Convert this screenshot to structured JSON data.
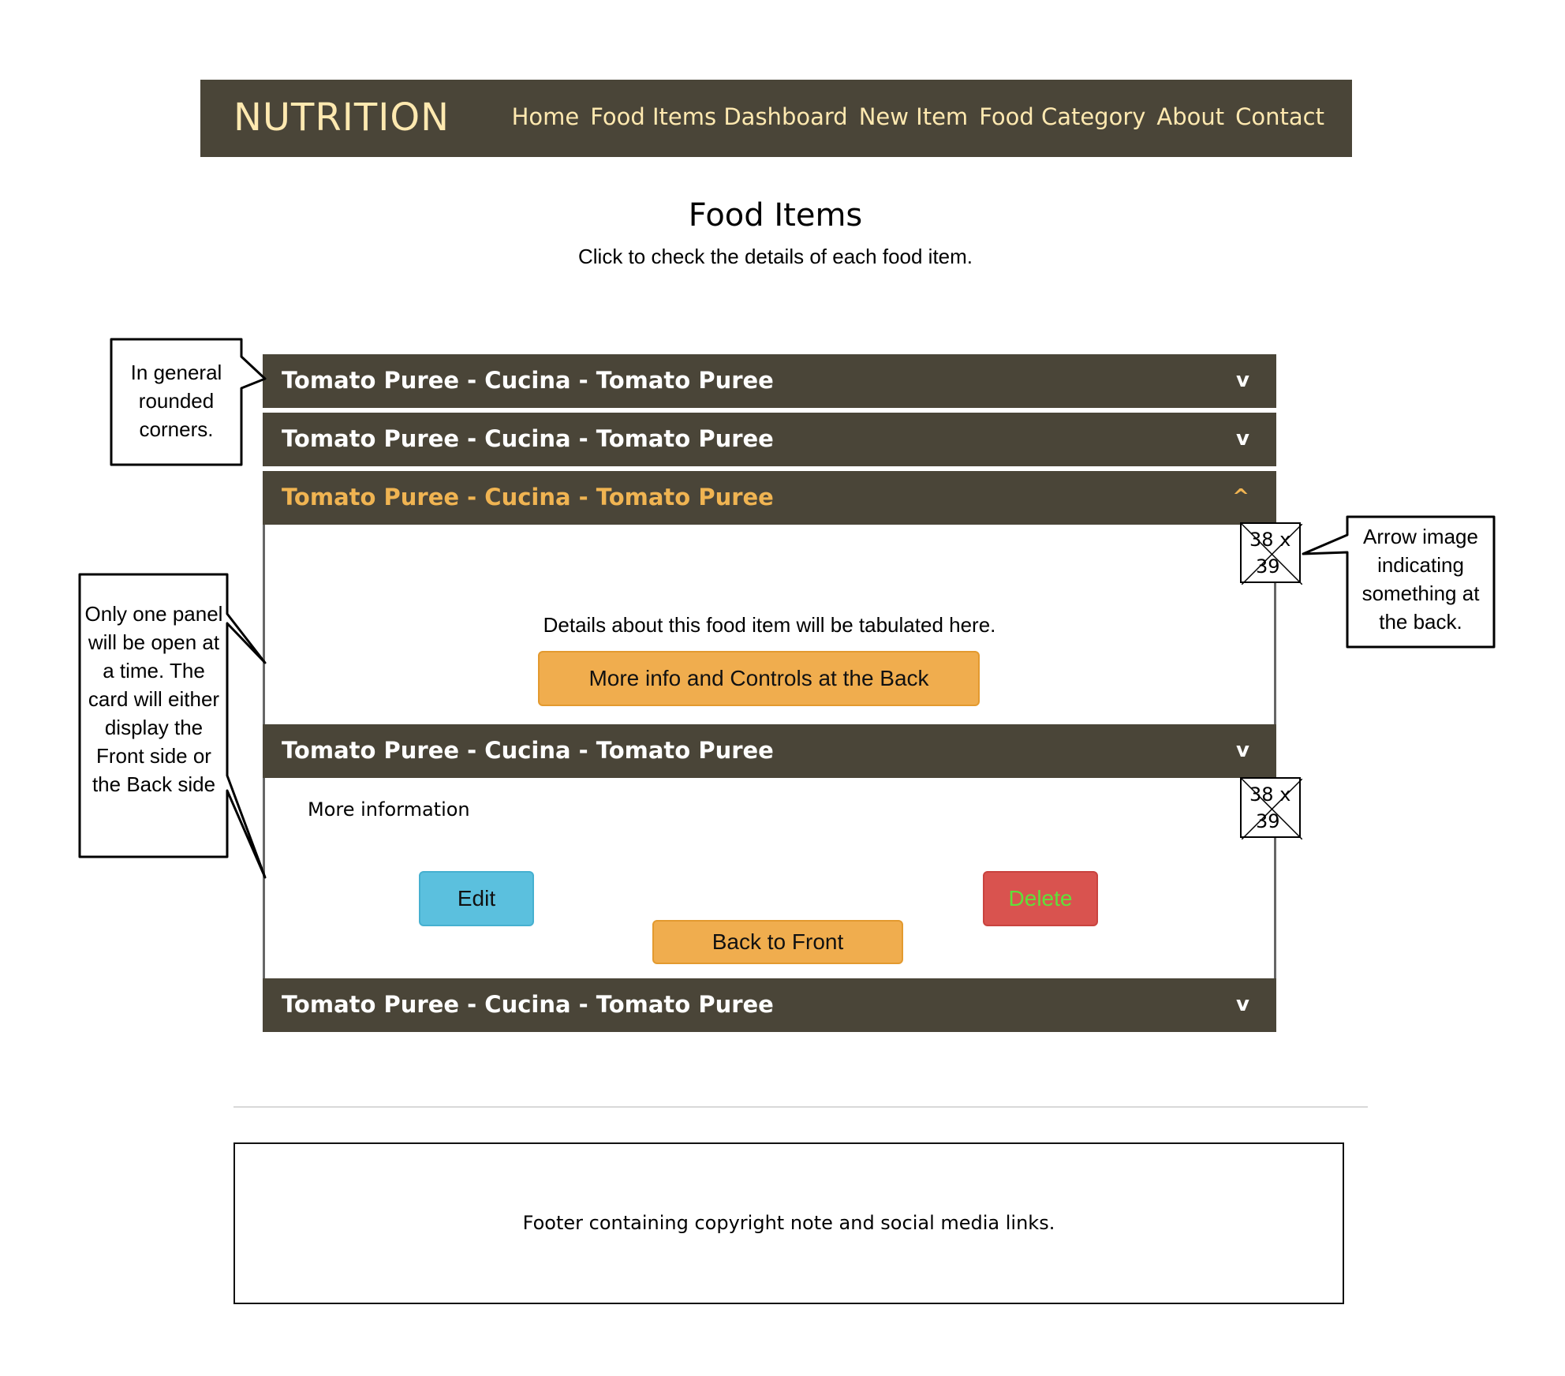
{
  "navbar": {
    "brand": "NUTRITION",
    "links": [
      "Home",
      "Food Items Dashboard",
      "New Item",
      "Food Category",
      "About",
      "Contact"
    ]
  },
  "page": {
    "title": "Food Items",
    "subtitle": "Click to check the details of each food item."
  },
  "accordion": [
    {
      "title": "Tomato Puree - Cucina - Tomato Puree",
      "chevron": "v"
    },
    {
      "title": "Tomato Puree - Cucina - Tomato Puree",
      "chevron": "v"
    },
    {
      "title": "Tomato Puree - Cucina - Tomato Puree",
      "chevron": "^"
    },
    {
      "title": "Tomato Puree - Cucina - Tomato Puree",
      "chevron": "v"
    },
    {
      "title": "Tomato Puree - Cucina - Tomato Puree",
      "chevron": "v"
    }
  ],
  "front_panel": {
    "details_text": "Details about this food item will be tabulated here.",
    "more_button": "More info and Controls at the Back",
    "image_placeholder": {
      "line1": "38 x",
      "line2": "39"
    }
  },
  "back_panel": {
    "heading": "More information",
    "edit_button": "Edit",
    "delete_button": "Delete",
    "back_button": "Back to Front",
    "image_placeholder": {
      "line1": "38 x",
      "line2": "39"
    }
  },
  "callouts": {
    "rounded": "In general rounded corners.",
    "one_panel": "Only one panel will be open at a time. The card will either display the Front side or the Back side",
    "arrow": "Arrow image indicating something at the back."
  },
  "footer": {
    "text": "Footer containing copyright note and social media links."
  },
  "colors": {
    "navbar_bg": "#4a4538",
    "brand_text": "#ffe9b0",
    "open_header_text": "#f0b452",
    "orange_button": "#f0ad4e",
    "edit_button": "#5bc0de",
    "delete_button": "#d9534f",
    "delete_text": "#5fe03a"
  }
}
